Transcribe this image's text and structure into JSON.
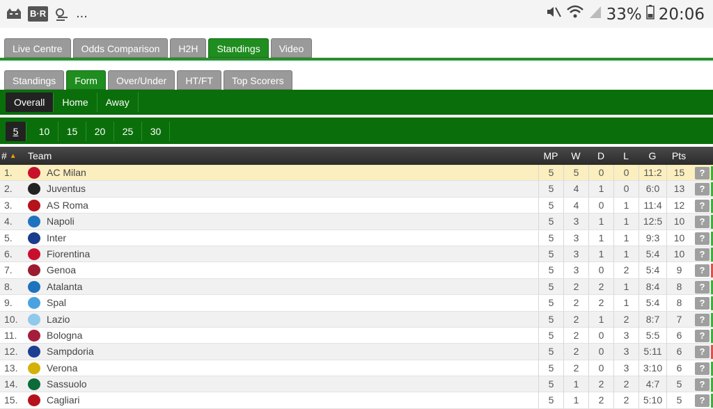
{
  "status_bar": {
    "left_icons": [
      "cat-icon",
      "br-icon",
      "weather-icon"
    ],
    "br_label": "B·R",
    "more": "...",
    "battery_percent": "33%",
    "time": "20:06"
  },
  "main_tabs": [
    {
      "label": "Live Centre",
      "active": false
    },
    {
      "label": "Odds Comparison",
      "active": false
    },
    {
      "label": "H2H",
      "active": false
    },
    {
      "label": "Standings",
      "active": true
    },
    {
      "label": "Video",
      "active": false
    }
  ],
  "sub_tabs": [
    {
      "label": "Standings",
      "active": false
    },
    {
      "label": "Form",
      "active": true
    },
    {
      "label": "Over/Under",
      "active": false
    },
    {
      "label": "HT/FT",
      "active": false
    },
    {
      "label": "Top Scorers",
      "active": false
    }
  ],
  "venue_tabs": [
    {
      "label": "Overall",
      "active": true
    },
    {
      "label": "Home",
      "active": false
    },
    {
      "label": "Away",
      "active": false
    }
  ],
  "match_counts": [
    {
      "label": "5",
      "active": true
    },
    {
      "label": "10",
      "active": false
    },
    {
      "label": "15",
      "active": false
    },
    {
      "label": "20",
      "active": false
    },
    {
      "label": "25",
      "active": false
    },
    {
      "label": "30",
      "active": false
    }
  ],
  "table": {
    "headers": {
      "rank": "#",
      "team": "Team",
      "mp": "MP",
      "w": "W",
      "d": "D",
      "l": "L",
      "g": "G",
      "pts": "Pts"
    },
    "rows": [
      {
        "rank": "1.",
        "team": "AC Milan",
        "mp": "5",
        "w": "5",
        "d": "0",
        "l": "0",
        "g": "11:2",
        "pts": "15",
        "logo_color": "#c8102e",
        "edge_color": "#3bb03b"
      },
      {
        "rank": "2.",
        "team": "Juventus",
        "mp": "5",
        "w": "4",
        "d": "1",
        "l": "0",
        "g": "6:0",
        "pts": "13",
        "logo_color": "#222222",
        "edge_color": "#3bb03b"
      },
      {
        "rank": "3.",
        "team": "AS Roma",
        "mp": "5",
        "w": "4",
        "d": "0",
        "l": "1",
        "g": "11:4",
        "pts": "12",
        "logo_color": "#b5121b",
        "edge_color": "#3bb03b"
      },
      {
        "rank": "4.",
        "team": "Napoli",
        "mp": "5",
        "w": "3",
        "d": "1",
        "l": "1",
        "g": "12:5",
        "pts": "10",
        "logo_color": "#1e73be",
        "edge_color": "#3bb03b"
      },
      {
        "rank": "5.",
        "team": "Inter",
        "mp": "5",
        "w": "3",
        "d": "1",
        "l": "1",
        "g": "9:3",
        "pts": "10",
        "logo_color": "#1b3c8c",
        "edge_color": "#3bb03b"
      },
      {
        "rank": "6.",
        "team": "Fiorentina",
        "mp": "5",
        "w": "3",
        "d": "1",
        "l": "1",
        "g": "5:4",
        "pts": "10",
        "logo_color": "#c8102e",
        "edge_color": "#3bb03b"
      },
      {
        "rank": "7.",
        "team": "Genoa",
        "mp": "5",
        "w": "3",
        "d": "0",
        "l": "2",
        "g": "5:4",
        "pts": "9",
        "logo_color": "#9b1b30",
        "edge_color": "#d9534f"
      },
      {
        "rank": "8.",
        "team": "Atalanta",
        "mp": "5",
        "w": "2",
        "d": "2",
        "l": "1",
        "g": "8:4",
        "pts": "8",
        "logo_color": "#1e73be",
        "edge_color": "#3bb03b"
      },
      {
        "rank": "9.",
        "team": "Spal",
        "mp": "5",
        "w": "2",
        "d": "2",
        "l": "1",
        "g": "5:4",
        "pts": "8",
        "logo_color": "#4aa3df",
        "edge_color": "#3bb03b"
      },
      {
        "rank": "10.",
        "team": "Lazio",
        "mp": "5",
        "w": "2",
        "d": "1",
        "l": "2",
        "g": "8:7",
        "pts": "7",
        "logo_color": "#8fc9ec",
        "edge_color": "#3bb03b"
      },
      {
        "rank": "11.",
        "team": "Bologna",
        "mp": "5",
        "w": "2",
        "d": "0",
        "l": "3",
        "g": "5:5",
        "pts": "6",
        "logo_color": "#a61c3c",
        "edge_color": "#3bb03b"
      },
      {
        "rank": "12.",
        "team": "Sampdoria",
        "mp": "5",
        "w": "2",
        "d": "0",
        "l": "3",
        "g": "5:11",
        "pts": "6",
        "logo_color": "#1c3f94",
        "edge_color": "#d9534f"
      },
      {
        "rank": "13.",
        "team": "Verona",
        "mp": "5",
        "w": "2",
        "d": "0",
        "l": "3",
        "g": "3:10",
        "pts": "6",
        "logo_color": "#d4b106",
        "edge_color": "#3bb03b"
      },
      {
        "rank": "14.",
        "team": "Sassuolo",
        "mp": "5",
        "w": "1",
        "d": "2",
        "l": "2",
        "g": "4:7",
        "pts": "5",
        "logo_color": "#0b6b3a",
        "edge_color": "#3bb03b"
      },
      {
        "rank": "15.",
        "team": "Cagliari",
        "mp": "5",
        "w": "1",
        "d": "2",
        "l": "2",
        "g": "5:10",
        "pts": "5",
        "logo_color": "#b5121b",
        "edge_color": "#3bb03b"
      }
    ]
  },
  "info_button_label": "?",
  "colors": {
    "accent_green": "#0a6f0a",
    "tab_active": "#1f8d1f",
    "highlight_row": "#fbefbf"
  }
}
